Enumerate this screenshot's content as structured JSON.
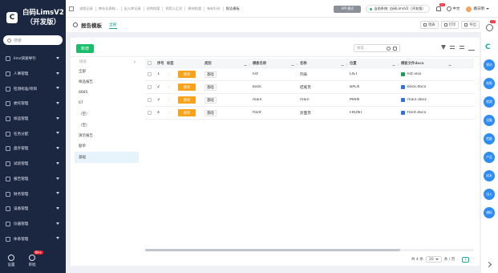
{
  "brand": {
    "name": "白码LimsV2",
    "sub": "（开发版）"
  },
  "sidebar": {
    "search_placeholder": "搜索",
    "items": [
      "lims快速导引",
      "人事管理",
      "检测标准/项目",
      "委托管理",
      "样品管理",
      "任务分配",
      "盘外管理",
      "试验管理",
      "报告管理",
      "财务管理",
      "设备管理",
      "仪器管理",
      "体系管理"
    ],
    "bottom": [
      {
        "label": "设置",
        "icon": "gear-icon"
      },
      {
        "label": "审批",
        "icon": "approval-icon",
        "badge": "99+"
      }
    ]
  },
  "topbar": {
    "tabs": [
      "流程记录",
      "库存告表耗...",
      "出入库记录",
      "试剂档案",
      "领用人汇总",
      "原材档案",
      "有料行价",
      "报告模板"
    ],
    "mode": "API 模式",
    "system": "当前系统: 白码LimsV2（开发版）",
    "bell_badge": "12",
    "language": "中文",
    "user": "路日明"
  },
  "subbar": {
    "title": "报告模板",
    "crumb": "全部",
    "buttons": [
      {
        "label": "图表",
        "icon": "chart-icon"
      },
      {
        "label": "打印",
        "icon": "print-icon"
      },
      {
        "label": "导出",
        "icon": "export-icon"
      }
    ]
  },
  "content": {
    "add_button": "新增",
    "search_placeholder": "搜索...",
    "left_list": {
      "search": "搜索",
      "items": [
        "全部",
        "样品报告",
        "8885",
        "67",
        "（空）",
        "（空）",
        "演示报告",
        "题单",
        "基础"
      ],
      "active_index": 8
    },
    "table": {
      "columns": [
        "",
        "序号",
        "标签",
        "",
        "类别",
        "模板名称",
        "名称",
        "位置",
        "模板文件docx"
      ],
      "rows": [
        {
          "no": "1",
          "edit": "修改",
          "category": "基础",
          "template": "list",
          "name": "列表",
          "position": "LIST",
          "file": "list.xlsx",
          "file_type": "xls"
        },
        {
          "no": "2",
          "edit": "修改",
          "category": "基础",
          "template": "back",
          "name": "结尾页",
          "position": "BACK",
          "file": "back.docx",
          "file_type": "doc"
        },
        {
          "no": "3",
          "edit": "修改",
          "category": "基础",
          "template": "main",
          "name": "main",
          "position": "MAIN",
          "file": "main.docx",
          "file_type": "doc"
        },
        {
          "no": "4",
          "edit": "修改",
          "category": "基础",
          "template": "front",
          "name": "封面页",
          "position": "FRONT",
          "file": "front.docx",
          "file_type": "doc"
        }
      ]
    },
    "pager": {
      "total": "共 4 条",
      "size": "20",
      "per": "条 / 页",
      "page": "1"
    }
  },
  "rightbar": {
    "badge": "17",
    "bubbles": [
      "探访",
      "拍照",
      "检测",
      "设备",
      "检量",
      "产品",
      "成本",
      "出入",
      "借料"
    ]
  }
}
